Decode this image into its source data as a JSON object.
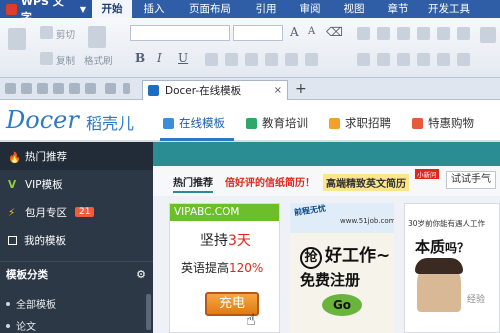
{
  "app": {
    "name": "WPS 文字",
    "menu_tabs": [
      "开始",
      "插入",
      "页面布局",
      "引用",
      "审阅",
      "视图",
      "章节",
      "开发工具"
    ],
    "active_menu": "开始"
  },
  "ribbon": {
    "cut": "剪切",
    "copy": "复制",
    "format_painter": "格式刷",
    "font_buttons": [
      "B",
      "I",
      "U"
    ]
  },
  "document_tab": {
    "title": "Docer-在线模板",
    "close": "×",
    "new_tab": "+"
  },
  "docer_header": {
    "logo_text": "Docer",
    "logo_cn": "稻壳儿",
    "nav": [
      {
        "label": "在线模板",
        "icon": "template-icon",
        "color": "#3a8fd8"
      },
      {
        "label": "教育培训",
        "icon": "book-icon",
        "color": "#2fa66a"
      },
      {
        "label": "求职招聘",
        "icon": "person-icon",
        "color": "#f3a12b"
      },
      {
        "label": "特惠购物",
        "icon": "shopping-icon",
        "color": "#e55a3a"
      }
    ],
    "active_nav": "在线模板"
  },
  "sidebar": {
    "items": [
      {
        "label": "热门推荐",
        "icon": "flame-icon"
      },
      {
        "label": "VIP模板",
        "icon": "vip-icon"
      },
      {
        "label": "包月专区",
        "icon": "lightning-icon",
        "badge": "21"
      },
      {
        "label": "我的模板",
        "icon": "square-icon"
      }
    ],
    "section_title": "模板分类",
    "sub_items": [
      "全部模板",
      "论文"
    ]
  },
  "content": {
    "tabs": [
      "热门推荐",
      "倍好评的信纸简历！",
      "高端精致英文简历"
    ],
    "hot_badge": "小新问",
    "speed_button": "试试手气",
    "cards": {
      "vipabc": {
        "brand": "VIPABC.COM",
        "line1_a": "坚持",
        "line1_b": "3天",
        "line2_a": "英语提高",
        "line2_b": "120%",
        "button": "充电"
      },
      "job51": {
        "logo": "前程无忧",
        "site": "www.51job.com",
        "line1_circle": "抢",
        "line1": "好工作~",
        "line2": "免费注册",
        "go": "Go"
      },
      "third": {
        "top": "30岁前你能有遇人工作",
        "big": "本质",
        "big_suffix": "吗？",
        "watermark": "经验"
      }
    }
  },
  "colors": {
    "titlebar": "#2f5ea6",
    "sidebar": "#2c3846",
    "teal": "#2a8d93",
    "accent_red": "#e0261b"
  }
}
